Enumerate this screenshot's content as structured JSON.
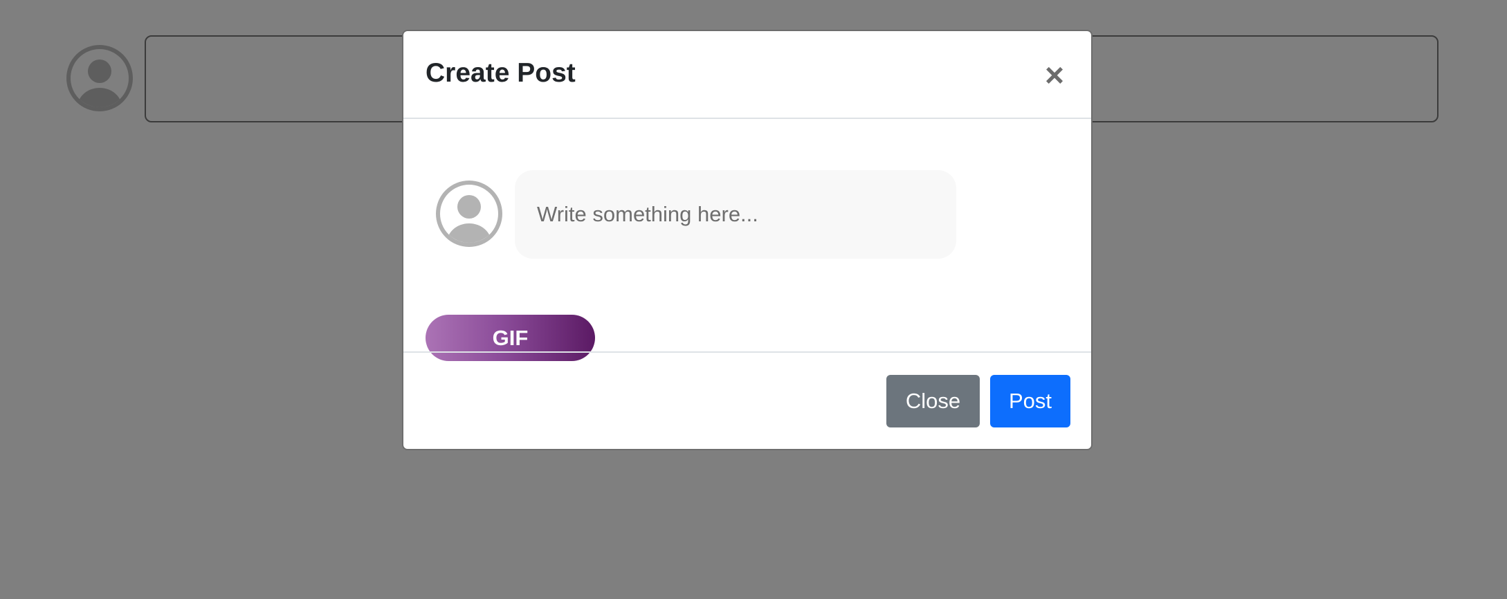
{
  "modal": {
    "title": "Create Post",
    "close_icon": "×",
    "input_placeholder": "Write something here...",
    "gif_label": "GIF",
    "close_label": "Close",
    "post_label": "Post"
  },
  "icons": {
    "avatar": "user-avatar-icon",
    "close": "close-icon"
  },
  "colors": {
    "close_button": "#6c757d",
    "post_button": "#0d6efd",
    "gif_gradient_start": "#ab73b5",
    "gif_gradient_end": "#5b1a64"
  }
}
